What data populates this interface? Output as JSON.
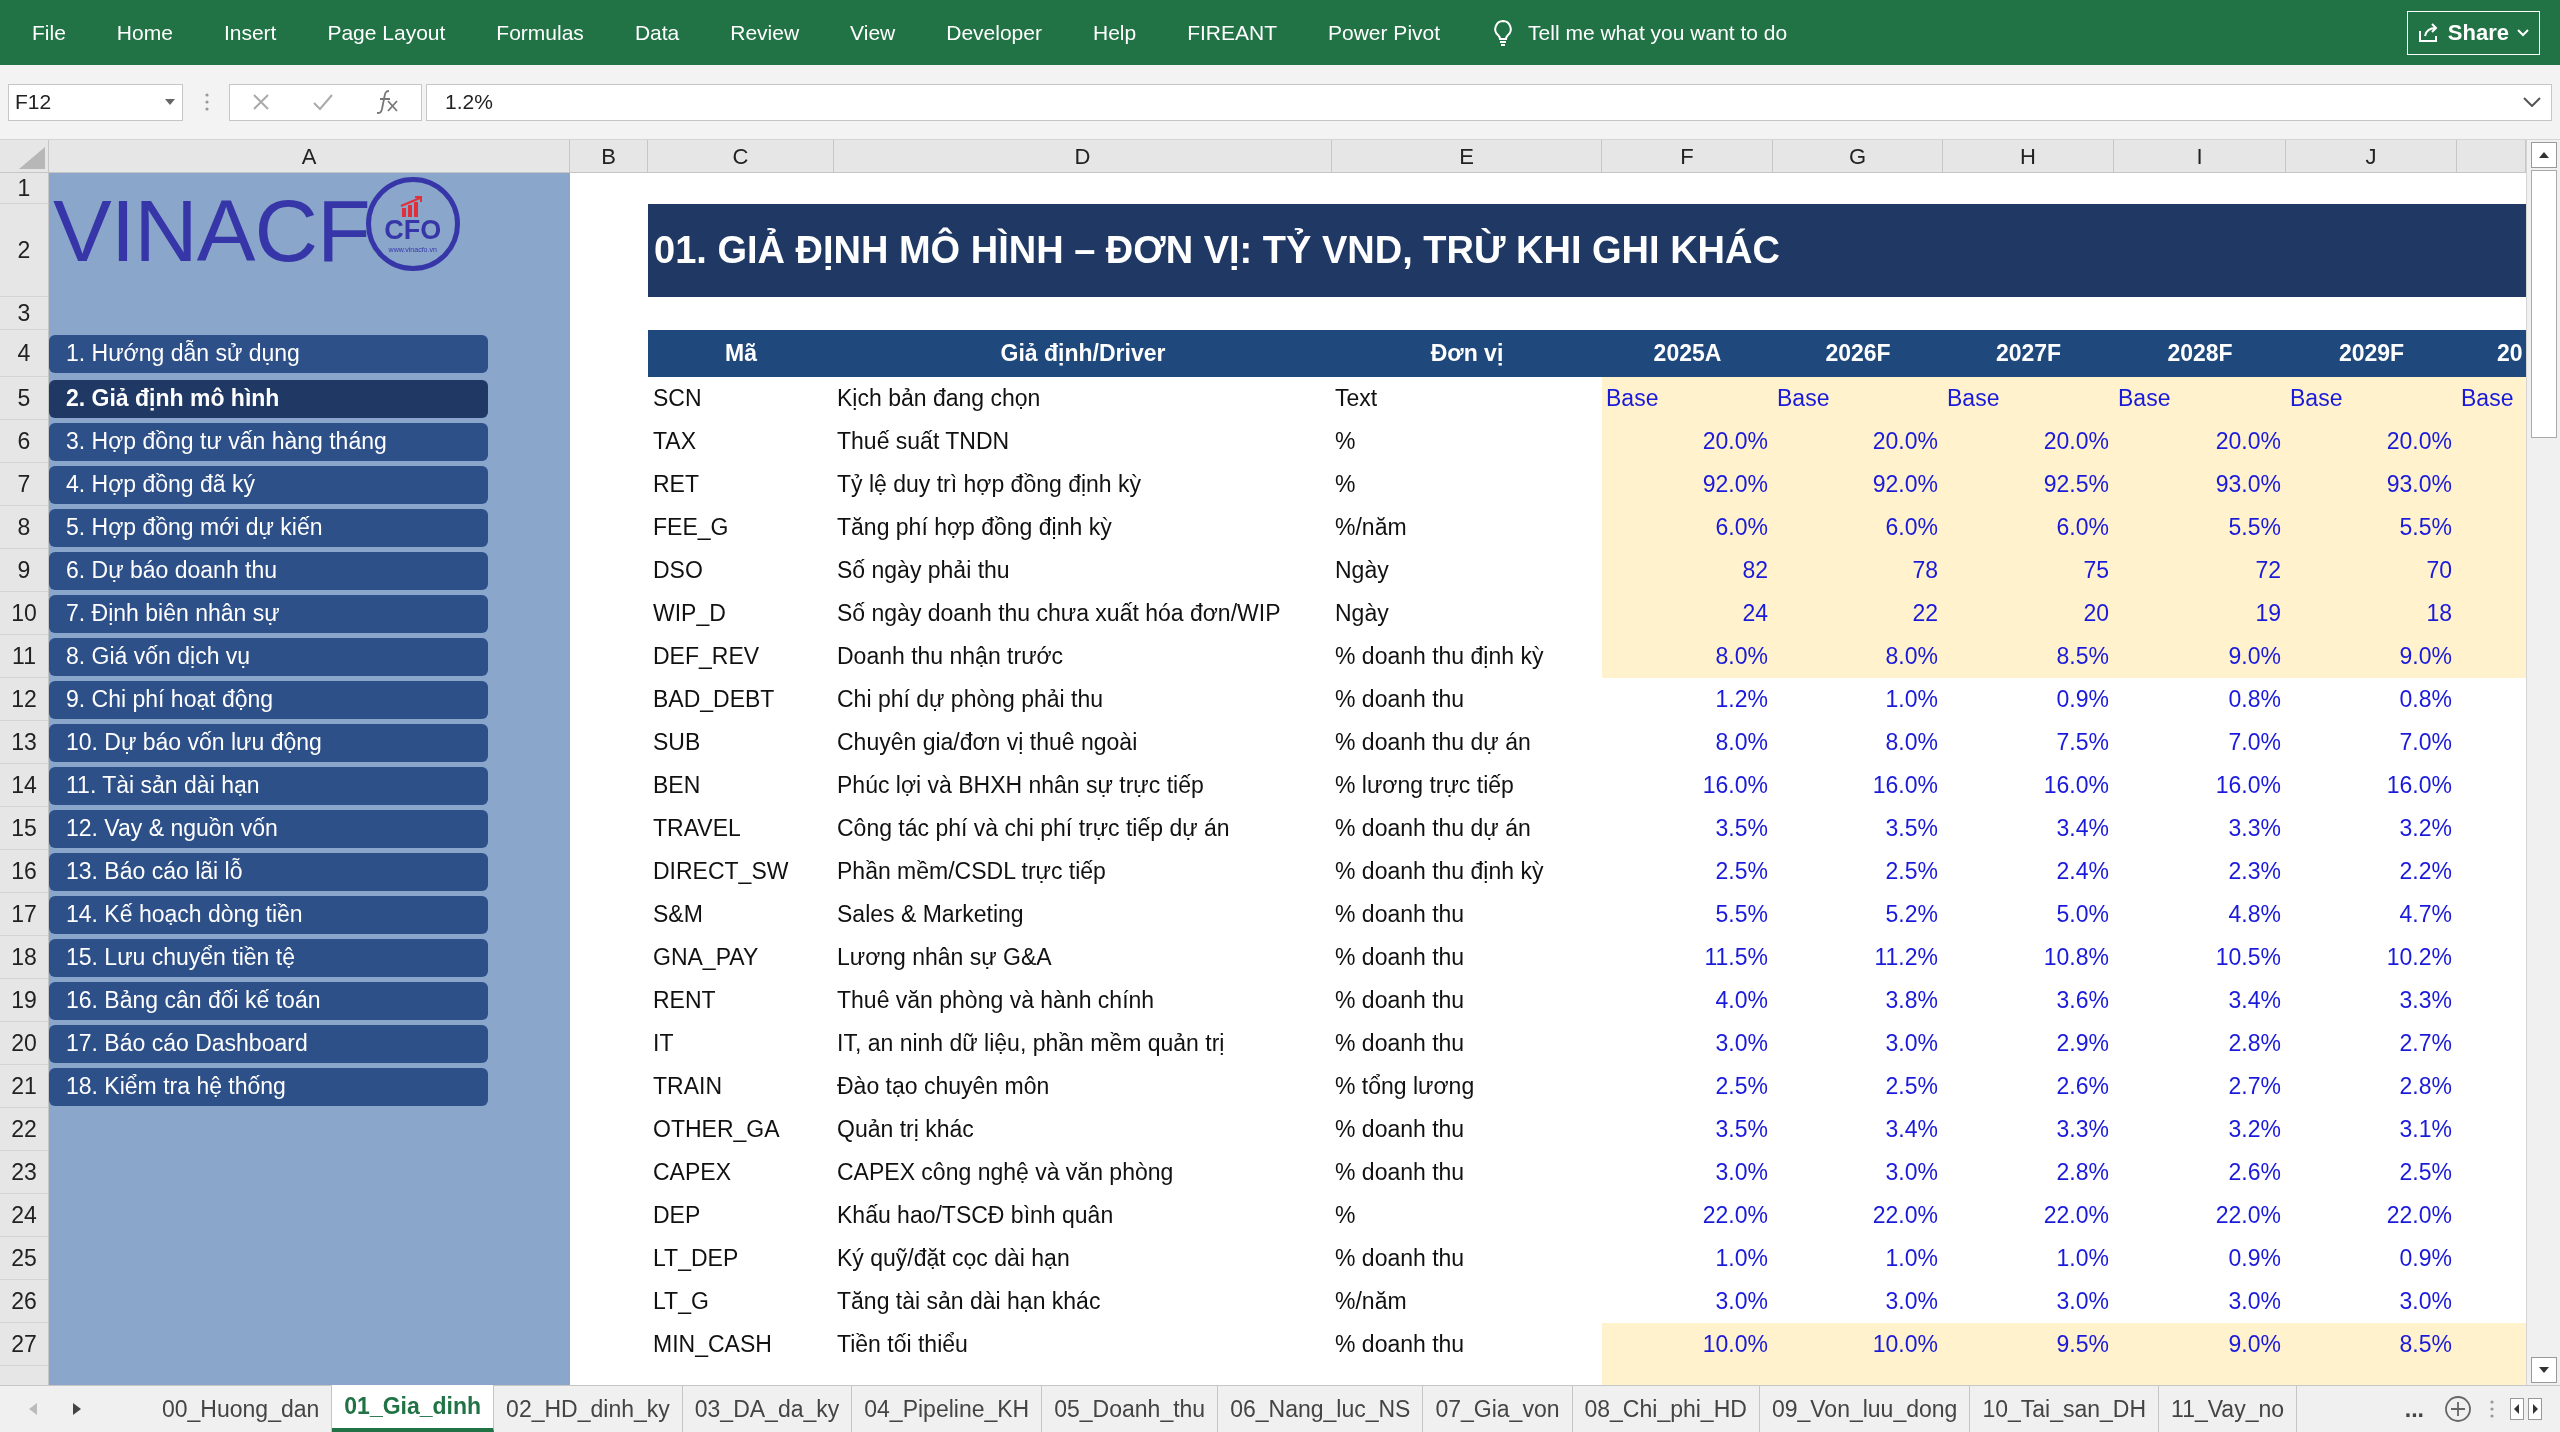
{
  "ribbon": {
    "tabs": [
      "File",
      "Home",
      "Insert",
      "Page Layout",
      "Formulas",
      "Data",
      "Review",
      "View",
      "Developer",
      "Help",
      "FIREANT",
      "Power Pivot"
    ],
    "tell_me": "Tell me what you want to do",
    "share": "Share"
  },
  "formula_bar": {
    "name_box": "F12",
    "formula": "1.2%"
  },
  "column_headers": [
    "A",
    "B",
    "C",
    "D",
    "E",
    "F",
    "G",
    "H",
    "I",
    "J"
  ],
  "row_headers": [
    "1",
    "2",
    "3",
    "4",
    "5",
    "6",
    "7",
    "8",
    "9",
    "10",
    "11",
    "12",
    "13",
    "14",
    "15",
    "16",
    "17",
    "18",
    "19",
    "20",
    "21",
    "22",
    "23",
    "24",
    "25",
    "26",
    "27"
  ],
  "sidebar": {
    "logo": {
      "wordmark": "VINACF",
      "badge": "CFO",
      "url": "www.vinacfo.vn"
    },
    "items": [
      {
        "label": "1. Hướng dẫn sử dụng",
        "selected": false
      },
      {
        "label": "2. Giả định mô hình",
        "selected": true
      },
      {
        "label": "3. Hợp đồng tư vấn hàng tháng",
        "selected": false
      },
      {
        "label": "4. Hợp đồng đã ký",
        "selected": false
      },
      {
        "label": "5. Hợp đồng mới dự kiến",
        "selected": false
      },
      {
        "label": "6. Dự báo doanh thu",
        "selected": false
      },
      {
        "label": "7. Định biên nhân sự",
        "selected": false
      },
      {
        "label": "8. Giá vốn dịch vụ",
        "selected": false
      },
      {
        "label": "9. Chi phí hoạt động",
        "selected": false
      },
      {
        "label": "10. Dự báo vốn lưu động",
        "selected": false
      },
      {
        "label": "11. Tài sản dài hạn",
        "selected": false
      },
      {
        "label": "12. Vay & nguồn vốn",
        "selected": false
      },
      {
        "label": "13. Báo cáo lãi lỗ",
        "selected": false
      },
      {
        "label": "14. Kế hoạch dòng tiền",
        "selected": false
      },
      {
        "label": "15. Lưu chuyển tiền tệ",
        "selected": false
      },
      {
        "label": "16. Bảng cân đối kế toán",
        "selected": false
      },
      {
        "label": "17. Báo cáo Dashboard",
        "selected": false
      },
      {
        "label": "18. Kiểm tra hệ thống",
        "selected": false
      }
    ]
  },
  "sheet": {
    "title": "01. GIẢ ĐỊNH MÔ HÌNH – ĐƠN VỊ: TỶ VND, TRỪ KHI GHI KHÁC",
    "header": [
      "Mã",
      "Giả định/Driver",
      "Đơn vị"
    ],
    "years": [
      "2025A",
      "2026F",
      "2027F",
      "2028F",
      "2029F",
      "20"
    ],
    "rows": [
      {
        "code": "SCN",
        "driver": "Kịch bản đang chọn",
        "unit": "Text",
        "kind": "text",
        "input": true,
        "values": [
          "Base",
          "Base",
          "Base",
          "Base",
          "Base",
          "Base"
        ]
      },
      {
        "code": "TAX",
        "driver": "Thuế suất TNDN",
        "unit": "%",
        "kind": "number",
        "input": true,
        "values": [
          "20.0%",
          "20.0%",
          "20.0%",
          "20.0%",
          "20.0%"
        ]
      },
      {
        "code": "RET",
        "driver": "Tỷ lệ duy trì hợp đồng định kỳ",
        "unit": "%",
        "kind": "number",
        "input": true,
        "values": [
          "92.0%",
          "92.0%",
          "92.5%",
          "93.0%",
          "93.0%"
        ]
      },
      {
        "code": "FEE_G",
        "driver": "Tăng phí hợp đồng định kỳ",
        "unit": "%/năm",
        "kind": "number",
        "input": true,
        "values": [
          "6.0%",
          "6.0%",
          "6.0%",
          "5.5%",
          "5.5%"
        ]
      },
      {
        "code": "DSO",
        "driver": "Số ngày phải thu",
        "unit": "Ngày",
        "kind": "number",
        "input": true,
        "values": [
          "82",
          "78",
          "75",
          "72",
          "70"
        ]
      },
      {
        "code": "WIP_D",
        "driver": "Số ngày doanh thu chưa xuất hóa đơn/WIP",
        "unit": "Ngày",
        "kind": "number",
        "input": true,
        "values": [
          "24",
          "22",
          "20",
          "19",
          "18"
        ]
      },
      {
        "code": "DEF_REV",
        "driver": "Doanh thu nhận trước",
        "unit": "% doanh thu định kỳ",
        "kind": "number",
        "input": true,
        "values": [
          "8.0%",
          "8.0%",
          "8.5%",
          "9.0%",
          "9.0%"
        ]
      },
      {
        "code": "BAD_DEBT",
        "driver": "Chi phí dự phòng phải thu",
        "unit": "% doanh thu",
        "kind": "number",
        "input": false,
        "values": [
          "1.2%",
          "1.0%",
          "0.9%",
          "0.8%",
          "0.8%"
        ]
      },
      {
        "code": "SUB",
        "driver": "Chuyên gia/đơn vị thuê ngoài",
        "unit": "% doanh thu dự án",
        "kind": "number",
        "input": false,
        "values": [
          "8.0%",
          "8.0%",
          "7.5%",
          "7.0%",
          "7.0%"
        ]
      },
      {
        "code": "BEN",
        "driver": "Phúc lợi và BHXH nhân sự trực tiếp",
        "unit": "% lương trực tiếp",
        "kind": "number",
        "input": false,
        "values": [
          "16.0%",
          "16.0%",
          "16.0%",
          "16.0%",
          "16.0%"
        ]
      },
      {
        "code": "TRAVEL",
        "driver": "Công tác phí và chi phí trực tiếp dự án",
        "unit": "% doanh thu dự án",
        "kind": "number",
        "input": false,
        "values": [
          "3.5%",
          "3.5%",
          "3.4%",
          "3.3%",
          "3.2%"
        ]
      },
      {
        "code": "DIRECT_SW",
        "driver": "Phần mềm/CSDL trực tiếp",
        "unit": "% doanh thu định kỳ",
        "kind": "number",
        "input": false,
        "values": [
          "2.5%",
          "2.5%",
          "2.4%",
          "2.3%",
          "2.2%"
        ]
      },
      {
        "code": "S&M",
        "driver": "Sales & Marketing",
        "unit": "% doanh thu",
        "kind": "number",
        "input": false,
        "values": [
          "5.5%",
          "5.2%",
          "5.0%",
          "4.8%",
          "4.7%"
        ]
      },
      {
        "code": "GNA_PAY",
        "driver": "Lương nhân sự G&A",
        "unit": "% doanh thu",
        "kind": "number",
        "input": false,
        "values": [
          "11.5%",
          "11.2%",
          "10.8%",
          "10.5%",
          "10.2%"
        ]
      },
      {
        "code": "RENT",
        "driver": "Thuê văn phòng và hành chính",
        "unit": "% doanh thu",
        "kind": "number",
        "input": false,
        "values": [
          "4.0%",
          "3.8%",
          "3.6%",
          "3.4%",
          "3.3%"
        ]
      },
      {
        "code": "IT",
        "driver": "IT, an ninh dữ liệu, phần mềm quản trị",
        "unit": "% doanh thu",
        "kind": "number",
        "input": false,
        "values": [
          "3.0%",
          "3.0%",
          "2.9%",
          "2.8%",
          "2.7%"
        ]
      },
      {
        "code": "TRAIN",
        "driver": "Đào tạo chuyên môn",
        "unit": "% tổng lương",
        "kind": "number",
        "input": false,
        "values": [
          "2.5%",
          "2.5%",
          "2.6%",
          "2.7%",
          "2.8%"
        ]
      },
      {
        "code": "OTHER_GA",
        "driver": "Quản trị khác",
        "unit": "% doanh thu",
        "kind": "number",
        "input": false,
        "values": [
          "3.5%",
          "3.4%",
          "3.3%",
          "3.2%",
          "3.1%"
        ]
      },
      {
        "code": "CAPEX",
        "driver": "CAPEX công nghệ và văn phòng",
        "unit": "% doanh thu",
        "kind": "number",
        "input": false,
        "values": [
          "3.0%",
          "3.0%",
          "2.8%",
          "2.6%",
          "2.5%"
        ]
      },
      {
        "code": "DEP",
        "driver": "Khấu hao/TSCĐ bình quân",
        "unit": "%",
        "kind": "number",
        "input": false,
        "values": [
          "22.0%",
          "22.0%",
          "22.0%",
          "22.0%",
          "22.0%"
        ]
      },
      {
        "code": "LT_DEP",
        "driver": "Ký quỹ/đặt cọc dài hạn",
        "unit": "% doanh thu",
        "kind": "number",
        "input": false,
        "values": [
          "1.0%",
          "1.0%",
          "1.0%",
          "0.9%",
          "0.9%"
        ]
      },
      {
        "code": "LT_G",
        "driver": "Tăng tài sản dài hạn khác",
        "unit": "%/năm",
        "kind": "number",
        "input": false,
        "values": [
          "3.0%",
          "3.0%",
          "3.0%",
          "3.0%",
          "3.0%"
        ]
      },
      {
        "code": "MIN_CASH",
        "driver": "Tiền tối thiểu",
        "unit": "% doanh thu",
        "kind": "number",
        "input": true,
        "values": [
          "10.0%",
          "10.0%",
          "9.5%",
          "9.0%",
          "8.5%"
        ]
      }
    ]
  },
  "sheet_tabs": [
    {
      "label": "00_Huong_dan",
      "selected": false
    },
    {
      "label": "01_Gia_dinh",
      "selected": true
    },
    {
      "label": "02_HD_dinh_ky",
      "selected": false
    },
    {
      "label": "03_DA_da_ky",
      "selected": false
    },
    {
      "label": "04_Pipeline_KH",
      "selected": false
    },
    {
      "label": "05_Doanh_thu",
      "selected": false
    },
    {
      "label": "06_Nang_luc_NS",
      "selected": false
    },
    {
      "label": "07_Gia_von",
      "selected": false
    },
    {
      "label": "08_Chi_phi_HD",
      "selected": false
    },
    {
      "label": "09_Von_luu_dong",
      "selected": false
    },
    {
      "label": "10_Tai_san_DH",
      "selected": false
    },
    {
      "label": "11_Vay_no",
      "selected": false
    }
  ],
  "more_tabs": "..."
}
